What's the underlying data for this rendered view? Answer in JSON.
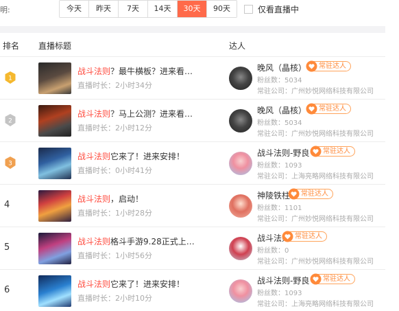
{
  "filter": {
    "label": "明:",
    "options": [
      "今天",
      "昨天",
      "7天",
      "14天",
      "30天",
      "90天"
    ],
    "selected": "30天",
    "only_live_label": "仅看直播中"
  },
  "table": {
    "headers": {
      "rank": "排名",
      "title": "直播标题",
      "talent": "达人"
    },
    "duration_prefix": "直播时长：",
    "fans_prefix": "粉丝数：",
    "company_prefix": "常驻公司：",
    "badge_label": "常驻达人",
    "rows": [
      {
        "rank": "1",
        "medal": "gold",
        "title_hl": "战斗法则",
        "title_rest": "？最牛横板？进来看…",
        "duration": "2小时34分",
        "name": "晚风（晶核）",
        "fans": "5034",
        "company": "广州妙悦网络科技有限公司"
      },
      {
        "rank": "2",
        "medal": "silver",
        "title_hl": "战斗法则",
        "title_rest": "？马上公测？进来看…",
        "duration": "2小时12分",
        "name": "晚风（晶核）",
        "fans": "5034",
        "company": "广州妙悦网络科技有限公司"
      },
      {
        "rank": "3",
        "medal": "bronze",
        "title_hl": "战斗法则",
        "title_rest": "它来了！进来安排！",
        "duration": "0小时41分",
        "name": "战斗法则-野良",
        "fans": "1093",
        "company": "上海亮略网络科技有限公司"
      },
      {
        "rank": "4",
        "medal": "",
        "title_hl": "战斗法则",
        "title_rest": "，启动！",
        "duration": "1小时28分",
        "name": "神陵铁柱",
        "fans": "1101",
        "company": "广州妙悦网络科技有限公司"
      },
      {
        "rank": "5",
        "medal": "",
        "title_hl": "战斗法则",
        "title_rest": "格斗手游9.28正式上…",
        "duration": "1小时56分",
        "name": "战斗法则",
        "fans": "0",
        "company": "广州妙悦网络科技有限公司"
      },
      {
        "rank": "6",
        "medal": "",
        "title_hl": "战斗法则",
        "title_rest": "它来了！进来安排！",
        "duration": "2小时10分",
        "name": "战斗法则-野良",
        "fans": "1093",
        "company": "上海亮略网络科技有限公司"
      }
    ]
  },
  "colors": {
    "accent": "#ff6a4a",
    "highlight": "#ff4a3d",
    "badge": "#ff8a3a"
  }
}
